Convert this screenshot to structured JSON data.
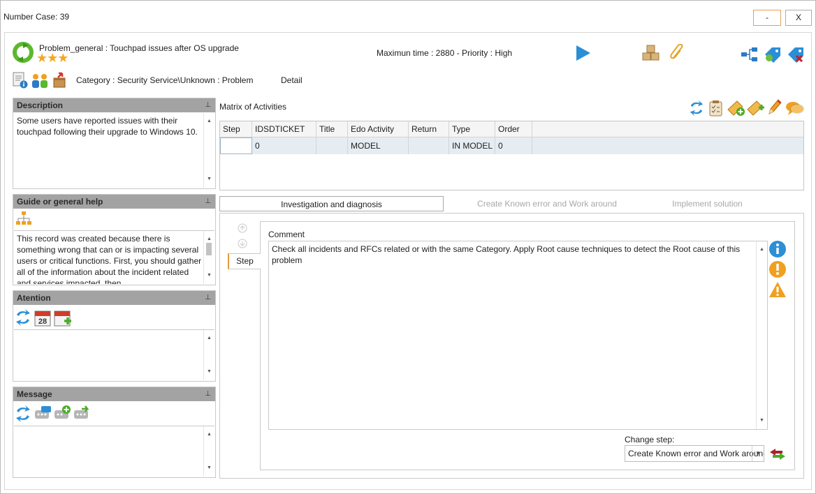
{
  "window": {
    "title": "Number Case: 39",
    "minimize_label": "-",
    "close_label": "X"
  },
  "header": {
    "case_title": "Problem_general : Touchpad issues after OS upgrade",
    "stars": "★★★",
    "max_time_line": "Maximun time : 2880  -  Priority : High",
    "category_line": "Category : Security Service\\Unknown : Problem",
    "detail_label": "Detail"
  },
  "panels": {
    "description": {
      "title": "Description",
      "pin": "⊥",
      "text": "Some users have reported issues with their touchpad following their upgrade to Windows 10."
    },
    "guide": {
      "title": "Guide or general help",
      "pin": "⊥",
      "text": "This record was created because there is something wrong that can or is impacting several users or critical functions. First, you should gather all of the information about the incident related and services impacted, then"
    },
    "atention": {
      "title": "Atention",
      "pin": "⊥",
      "calendar_day": "28"
    },
    "message": {
      "title": "Message",
      "pin": "⊥"
    }
  },
  "matrix": {
    "title": "Matrix of Activities",
    "columns": [
      "Step",
      "IDSDTICKET",
      "Title",
      "Edo Activity",
      "Return",
      "Type",
      "Order"
    ],
    "rows": [
      [
        "",
        "0",
        "",
        "MODEL",
        "",
        "IN MODEL",
        "0"
      ]
    ]
  },
  "tabs": [
    {
      "label": "Investigation and diagnosis",
      "active": true
    },
    {
      "label": "Create Known error and Work around",
      "active": false
    },
    {
      "label": "Implement solution",
      "active": false
    }
  ],
  "step_tab_label": "Step",
  "comment": {
    "label": "Comment",
    "text": "Check all incidents and RFCs related or with the same Category. Apply Root  cause techniques to detect the Root cause of this problem"
  },
  "change_step": {
    "label": "Change step:",
    "selected": "Create Known error and Work around"
  },
  "colors": {
    "panel_header": "#a3a3a3",
    "accent_orange": "#e29a3c",
    "selected_row": "#e6edf2",
    "info_blue": "#2d8fd5",
    "warn_orange": "#f0a020"
  }
}
